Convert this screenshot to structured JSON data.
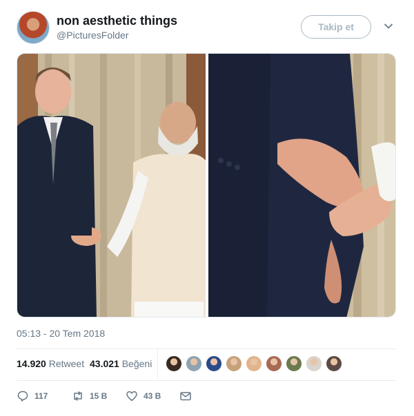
{
  "tweet": {
    "display_name": "non aesthetic things",
    "handle": "@PicturesFolder",
    "follow_label": "Takip et",
    "timestamp": "05:13 - 20 Tem 2018"
  },
  "stats": {
    "retweet_count": "14.920",
    "retweet_label": "Retweet",
    "like_count": "43.021",
    "like_label": "Beğeni"
  },
  "likers": {
    "count_shown": 9,
    "colors": [
      "#3b2a22",
      "#8fa3b0",
      "#2b4a8a",
      "#c6a27a",
      "#e2b48a",
      "#a86a55",
      "#6a7b4f",
      "#d9d4cc",
      "#5c4a44"
    ]
  },
  "actions": {
    "reply_count": "117",
    "retweet_count": "15 B",
    "like_count": "43 B"
  },
  "colors": {
    "text_primary": "#14171a",
    "text_secondary": "#657786",
    "border": "#e6ecf0"
  }
}
